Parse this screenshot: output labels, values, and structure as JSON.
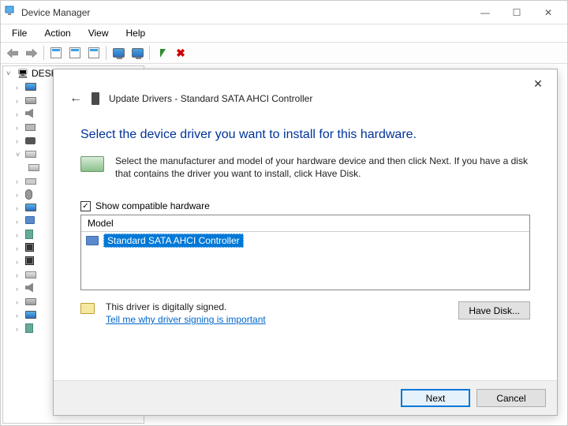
{
  "window": {
    "title": "Device Manager",
    "controls": {
      "minimize": "—",
      "maximize": "☐",
      "close": "✕"
    }
  },
  "menubar": {
    "items": [
      "File",
      "Action",
      "View",
      "Help"
    ]
  },
  "toolbar": {
    "icons": [
      "back-arrow",
      "forward-arrow",
      "sep",
      "properties",
      "help",
      "sep",
      "update",
      "uninstall",
      "scan",
      "sep",
      "monitor",
      "green-up",
      "red-x"
    ]
  },
  "tree": {
    "root": "DESKTOP-LDIDKBU",
    "root_exp": "˅",
    "expand_closed": "›",
    "expand_open": "˅"
  },
  "dialog": {
    "close": "✕",
    "back": "←",
    "title": "Update Drivers - Standard SATA AHCI Controller",
    "headline": "Select the device driver you want to install for this hardware.",
    "instruction": "Select the manufacturer and model of your hardware device and then click Next. If you have a disk that contains the driver you want to install, click Have Disk.",
    "checkbox_label": "Show compatible hardware",
    "checkbox_checked": "✓",
    "list_header": "Model",
    "selected_item": "Standard SATA AHCI Controller",
    "signed_text": "This driver is digitally signed.",
    "signed_link": "Tell me why driver signing is important",
    "have_disk": "Have Disk...",
    "next": "Next",
    "cancel": "Cancel"
  }
}
